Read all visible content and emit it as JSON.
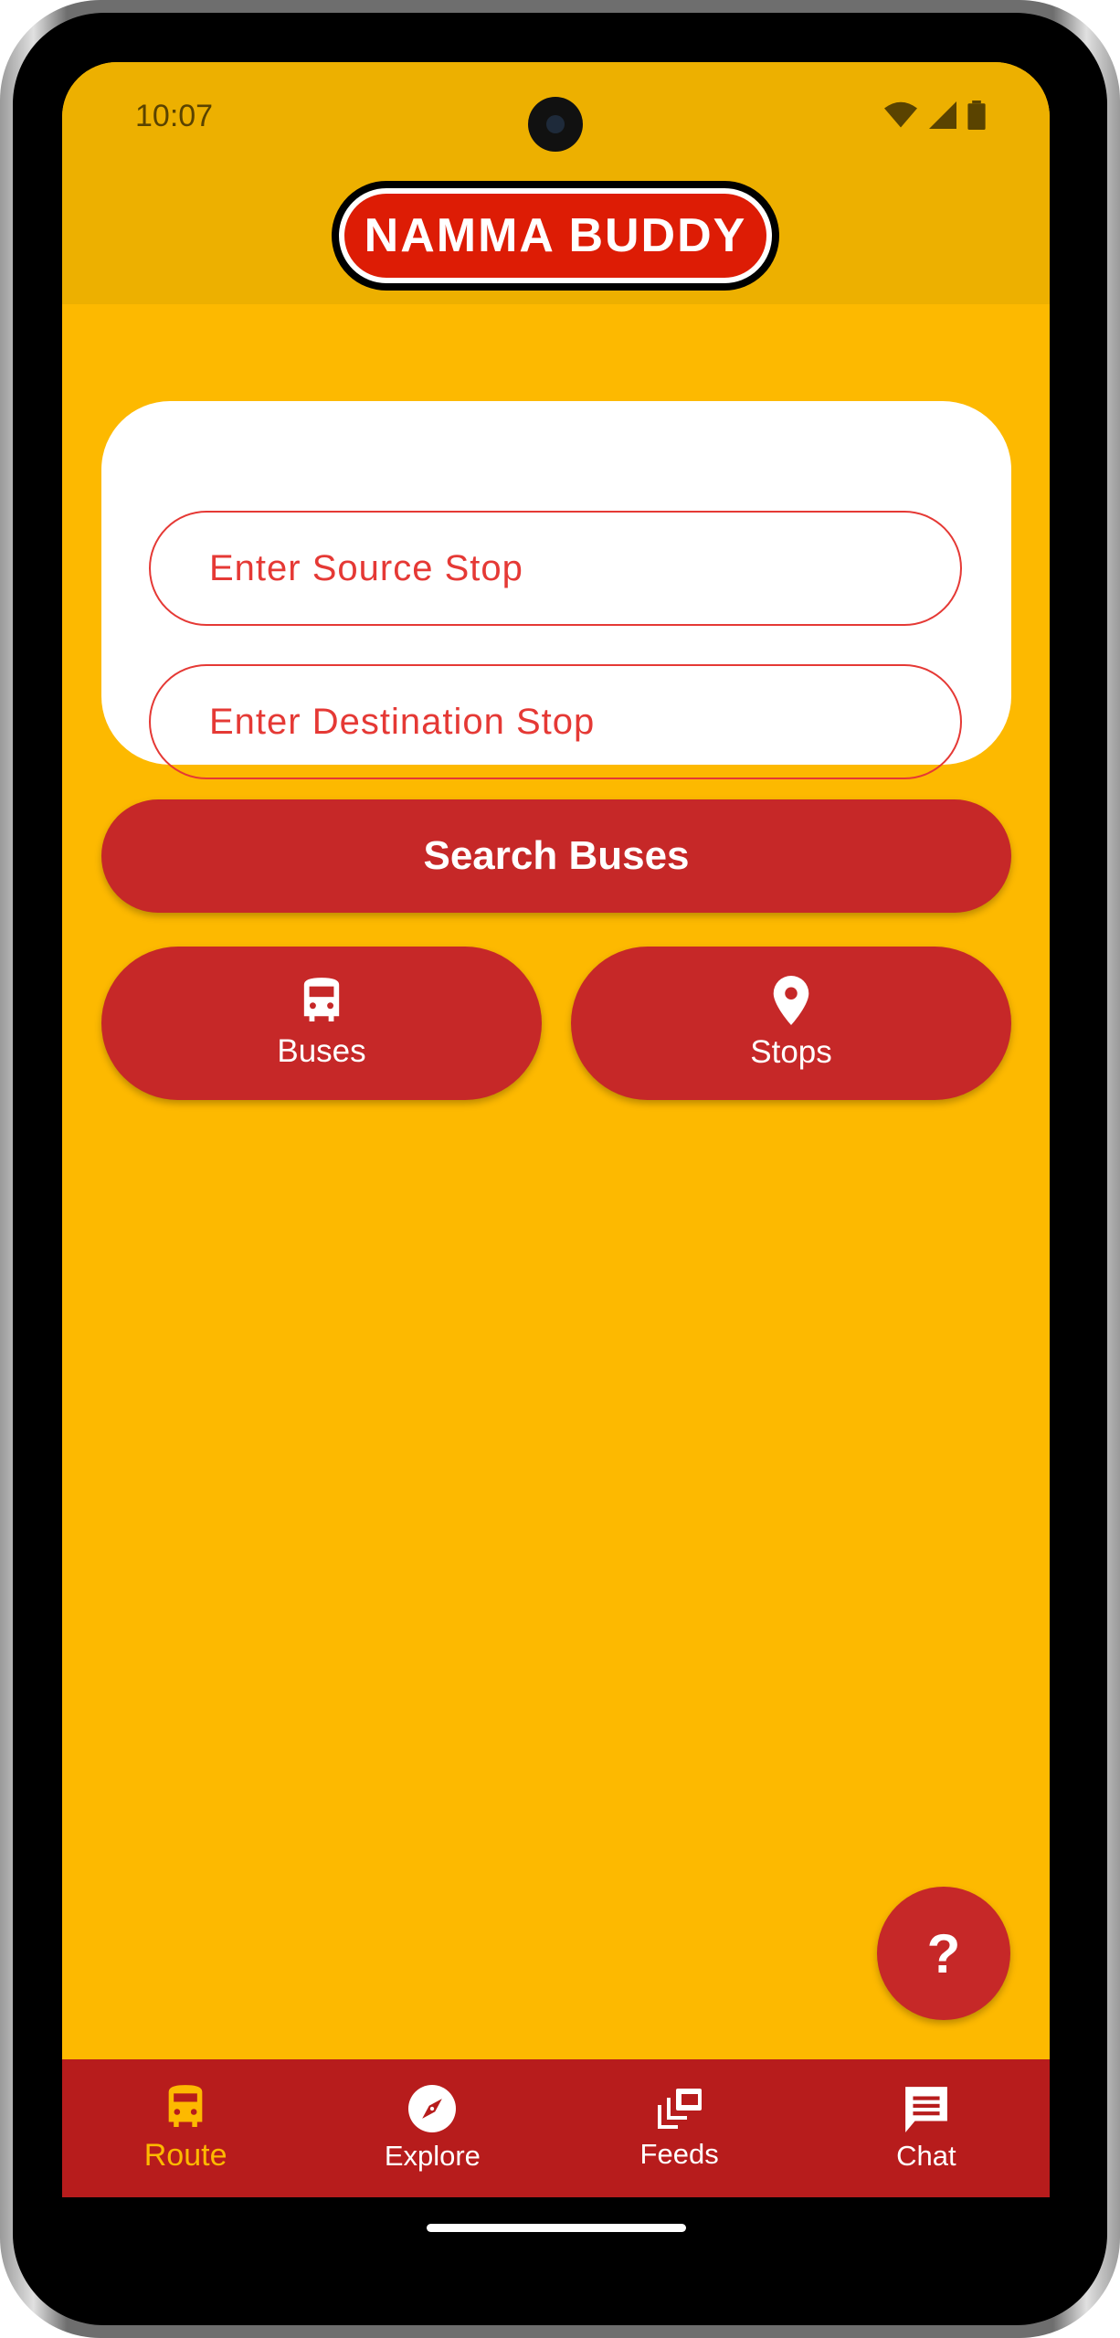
{
  "status_bar": {
    "time": "10:07"
  },
  "app": {
    "logo_text": "NAMMA BUDDY"
  },
  "form": {
    "source_placeholder": "Enter Source Stop",
    "destination_placeholder": "Enter Destination Stop",
    "search_label": "Search Buses"
  },
  "quick_actions": [
    {
      "label": "Buses",
      "icon": "bus-icon"
    },
    {
      "label": "Stops",
      "icon": "location-pin-icon"
    }
  ],
  "fab": {
    "label": "?"
  },
  "bottom_nav": {
    "items": [
      {
        "label": "Route",
        "icon": "bus-icon",
        "active": true
      },
      {
        "label": "Explore",
        "icon": "compass-icon"
      },
      {
        "label": "Feeds",
        "icon": "feeds-icon"
      },
      {
        "label": "Chat",
        "icon": "chat-icon"
      }
    ]
  },
  "colors": {
    "primary": "#C62828",
    "nav": "#B71C1C",
    "background": "#FDB900",
    "appbar": "#EDB000"
  }
}
